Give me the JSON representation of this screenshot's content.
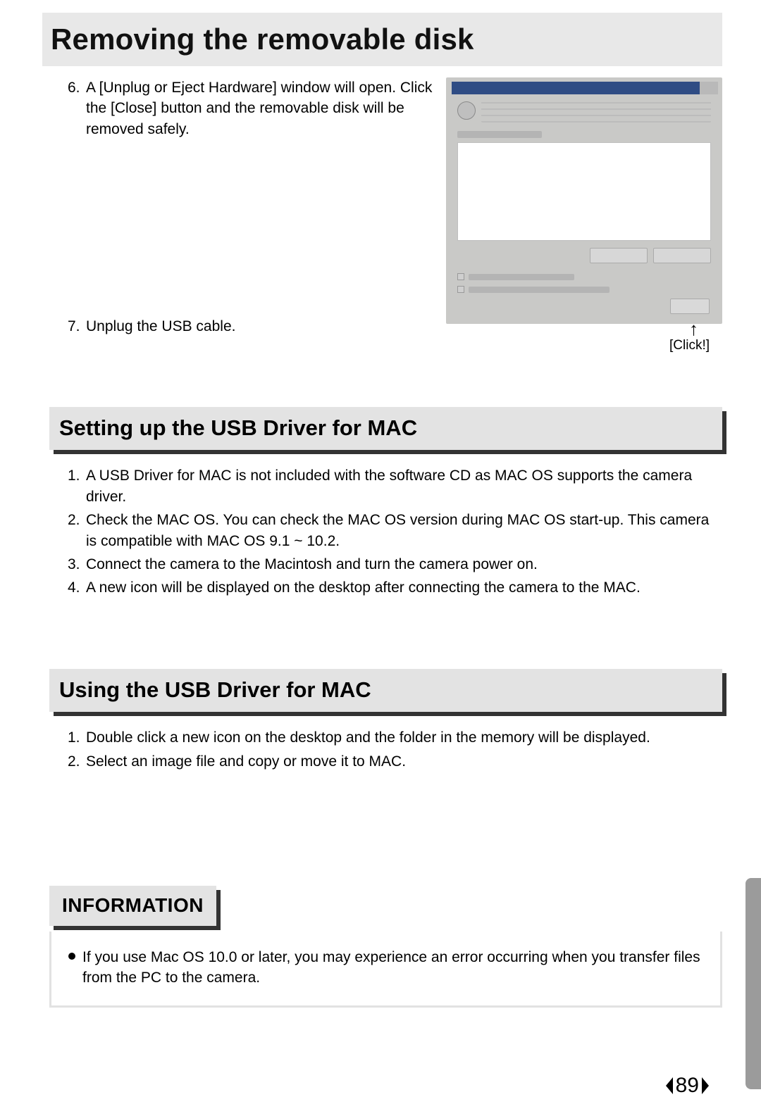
{
  "title": "Removing the removable disk",
  "removing": {
    "step6_num": "6.",
    "step6": "A [Unplug or Eject Hardware] window will open. Click the [Close] button and the removable disk will be removed safely.",
    "step7_num": "7.",
    "step7": "Unplug the USB cable.",
    "click_label": "[Click!]"
  },
  "section1": {
    "heading": "Setting up the USB Driver for MAC",
    "items": [
      {
        "num": "1.",
        "text": "A USB Driver for MAC is not included with the software CD as MAC OS supports the camera driver."
      },
      {
        "num": "2.",
        "text": "Check the MAC OS. You can check the MAC OS version during MAC OS start-up. This camera is compatible with MAC OS 9.1 ~ 10.2."
      },
      {
        "num": "3.",
        "text": "Connect the camera to the Macintosh and turn the camera power on."
      },
      {
        "num": "4.",
        "text": "A new icon will be displayed on the desktop after connecting the camera to the MAC."
      }
    ]
  },
  "section2": {
    "heading": "Using the USB Driver for MAC",
    "items": [
      {
        "num": "1.",
        "text": "Double click a new icon on the desktop and the folder in the memory will be displayed."
      },
      {
        "num": "2.",
        "text": "Select an image file and copy or move it to MAC."
      }
    ]
  },
  "info": {
    "heading": "INFORMATION",
    "bullet": "If you use Mac OS 10.0 or later, you may experience an error occurring when you transfer files from the PC to the camera."
  },
  "page_number": "89"
}
